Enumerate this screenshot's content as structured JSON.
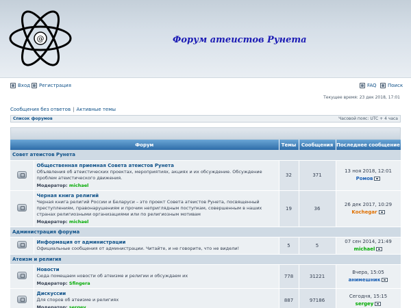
{
  "header": {
    "title": "Форум атеистов Рунета"
  },
  "nav": {
    "login": "Вход",
    "register": "Регистрация",
    "faq": "FAQ",
    "search": "Поиск"
  },
  "current_time": "Текущее время: 23 дек 2018, 17:01",
  "links": {
    "unanswered": "Сообщения без ответов",
    "sep": "|",
    "active": "Активные темы"
  },
  "breadcrumb": {
    "forum_list": "Список форумов",
    "timezone": "Часовой пояс: UTC + 4 часа"
  },
  "table_headers": {
    "forum": "Форум",
    "topics": "Темы",
    "posts": "Сообщения",
    "last_post": "Последнее сообщение"
  },
  "categories": [
    {
      "name": "Совет атеистов Рунета",
      "forums": [
        {
          "title": "Общественная приемная Совета атеистов Рунета",
          "desc": "Объявления об атеистических проектах, мероприятиях, акциях и их обсуждение. Обсуждение проблем атеистического движения.",
          "mod_label": "Модератор:",
          "mod_name": "michael",
          "topics": "32",
          "posts": "371",
          "last_date": "13 ноя 2018, 12:01",
          "last_user": "Ромов",
          "last_user_color": "#1a5fb4"
        },
        {
          "title": "Черная книга религий",
          "desc": "Черная книга религий России и Беларуси – это проект Совета атеистов Рунета, посвященный преступлениям, правонарушениям и прочим неприглядным поступкам, совершенным в наших странах религиозными организациями или по религиозным мотивам",
          "mod_label": "Модератор:",
          "mod_name": "michael",
          "topics": "19",
          "posts": "36",
          "last_date": "26 дек 2017, 10:29",
          "last_user": "Kochegar",
          "last_user_color": "#e07000"
        }
      ]
    },
    {
      "name": "Администрация форума",
      "forums": [
        {
          "title": "Информация от администрации",
          "desc": "Официальные сообщения от администрации. Читайте, и не говорите, что не видели!",
          "mod_label": "",
          "mod_name": "",
          "topics": "5",
          "posts": "5",
          "last_date": "07 сен 2014, 21:49",
          "last_user": "michael",
          "last_user_color": "#00aa00"
        }
      ]
    },
    {
      "name": "Атеизм и религия",
      "forums": [
        {
          "title": "Новости",
          "desc": "Сюда помещаем новости об атеизме и религии и обсуждаем их",
          "mod_label": "Модератор:",
          "mod_name": "Sfingera",
          "topics": "778",
          "posts": "31221",
          "last_date": "Вчера, 15:05",
          "last_user": "анимешник",
          "last_user_color": "#1a5fb4"
        },
        {
          "title": "Дискуссии",
          "desc": "Для споров об атеизме и религиях",
          "mod_label": "Модератор:",
          "mod_name": "sergey",
          "topics": "887",
          "posts": "97186",
          "last_date": "Сегодня, 15:15",
          "last_user": "sergey",
          "last_user_color": "#00aa00"
        }
      ]
    }
  ],
  "colors": {
    "link": "#105289",
    "header_grad_top": "#6aa6d6",
    "header_grad_bottom": "#2e6ca8",
    "moderator": "#00aa00"
  }
}
